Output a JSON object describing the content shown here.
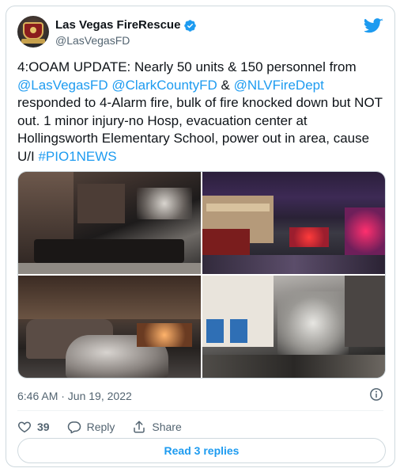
{
  "account": {
    "display_name": "Las Vegas FireRescue",
    "handle": "@LasVegasFD"
  },
  "tweet": {
    "segments": [
      {
        "text": "4:OOAM UPDATE: Nearly 50 units & 150 personnel from ",
        "type": "text"
      },
      {
        "text": "@LasVegasFD",
        "type": "mention"
      },
      {
        "text": " ",
        "type": "text"
      },
      {
        "text": "@ClarkCountyFD",
        "type": "mention"
      },
      {
        "text": " & ",
        "type": "text"
      },
      {
        "text": "@NLVFireDept",
        "type": "mention"
      },
      {
        "text": " responded to 4-Alarm fire, bulk of fire knocked down but NOT out. 1 minor injury-no Hosp, evacuation center at Hollingsworth Elementary School, power out in area, cause U/I ",
        "type": "text"
      },
      {
        "text": "#PIO1NEWS",
        "type": "mention"
      }
    ]
  },
  "media": {
    "photo_count": 4
  },
  "meta": {
    "timestamp": "6:46 AM · Jun 19, 2022"
  },
  "actions": {
    "like_count": "39",
    "reply_label": "Reply",
    "share_label": "Share"
  },
  "replies_button": {
    "label": "Read 3 replies"
  },
  "colors": {
    "accent": "#1d9bf0",
    "text": "#0f1419",
    "secondary": "#536471",
    "border": "#cfd9de"
  },
  "icons": [
    "twitter-bird-icon",
    "verified-badge-icon",
    "info-icon",
    "heart-icon",
    "reply-bubble-icon",
    "share-icon"
  ]
}
